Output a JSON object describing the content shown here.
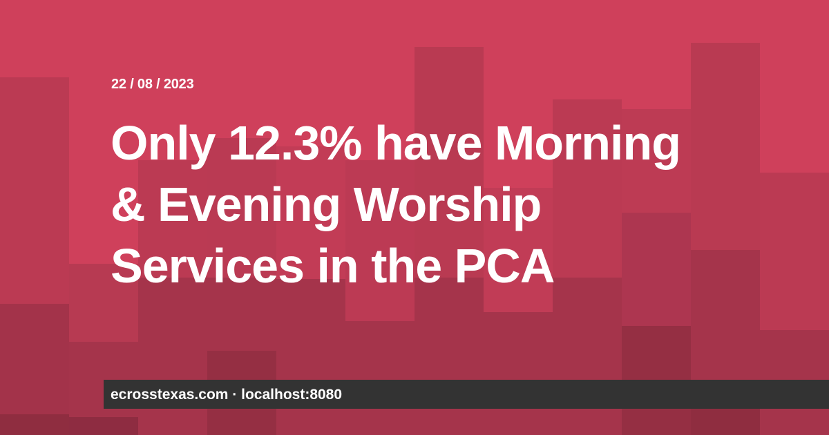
{
  "post": {
    "date": "22 / 08 / 2023",
    "title_line1": "Only 12.3% have Morning",
    "title_line2": "& Evening Worship",
    "title_line3": "Services in the PCA"
  },
  "footer": {
    "site": "ecrosstexas.com",
    "separator": "·",
    "host": "localhost:8080"
  },
  "colors": {
    "background": "#cf405b",
    "footer_background": "#333333",
    "text": "#ffffff"
  }
}
